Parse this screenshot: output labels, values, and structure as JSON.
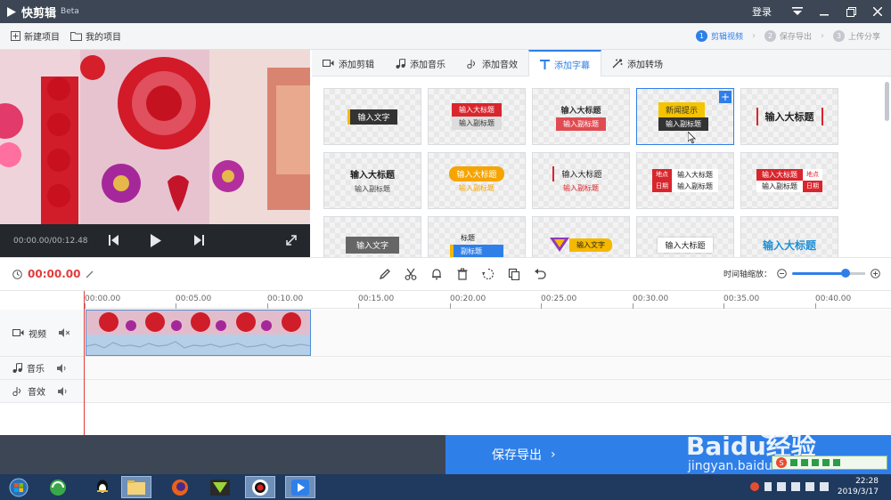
{
  "app": {
    "name": "快剪辑",
    "badge": "Beta",
    "login": "登录"
  },
  "menu": {
    "new_project": "新建项目",
    "my_projects": "我的项目"
  },
  "steps": [
    {
      "num": "1",
      "label": "剪辑视频"
    },
    {
      "num": "2",
      "label": "保存导出"
    },
    {
      "num": "3",
      "label": "上传分享"
    }
  ],
  "preview": {
    "time": "00:00.00/00:12.48"
  },
  "tabs": [
    "添加剪辑",
    "添加音乐",
    "添加音效",
    "添加字幕",
    "添加转场"
  ],
  "templates": {
    "t1": "输入文字",
    "t2a": "输入大标题",
    "t2b": "输入副标题",
    "t3a": "输入大标题",
    "t3b": "输入副标题",
    "t4a": "新闻提示",
    "t4b": "输入副标题",
    "t5": "输入大标题",
    "t6a": "输入大标题",
    "t6b": "输入副标题",
    "t7a": "输入大标题",
    "t7b": "输入副标题",
    "t8a": "输入大标题",
    "t8b": "输入副标题",
    "t9a": "地点",
    "t9b": "输入大标题",
    "t9c": "日期",
    "t9d": "输入副标题",
    "t10a": "输入大标题",
    "t10b": "地点",
    "t10c": "输入副标题",
    "t10d": "日期",
    "t11": "输入文字",
    "t12a": "标题",
    "t12b": "副标题",
    "t13": "输入文字",
    "t14": "输入大标题",
    "t15": "输入大标题"
  },
  "toolbar": {
    "time": "00:00.00",
    "zoom_label": "时间轴缩放：",
    "zoom_level": 0.73
  },
  "ruler": [
    "00:00.00",
    "00:05.00",
    "00:10.00",
    "00:15.00",
    "00:20.00",
    "00:25.00",
    "00:30.00",
    "00:35.00",
    "00:40.00"
  ],
  "tracks": {
    "video": "视频",
    "music": "音乐",
    "sfx": "音效"
  },
  "export": {
    "label": "保存导出"
  },
  "taskbar": {
    "time": "22:28",
    "date": "2019/3/17"
  },
  "watermark": {
    "brand": "Baidu经验",
    "url": "jingyan.baidu.com"
  },
  "colors": {
    "accent": "#2f7fe8",
    "dark": "#3d4654",
    "red": "#e23b3b"
  }
}
